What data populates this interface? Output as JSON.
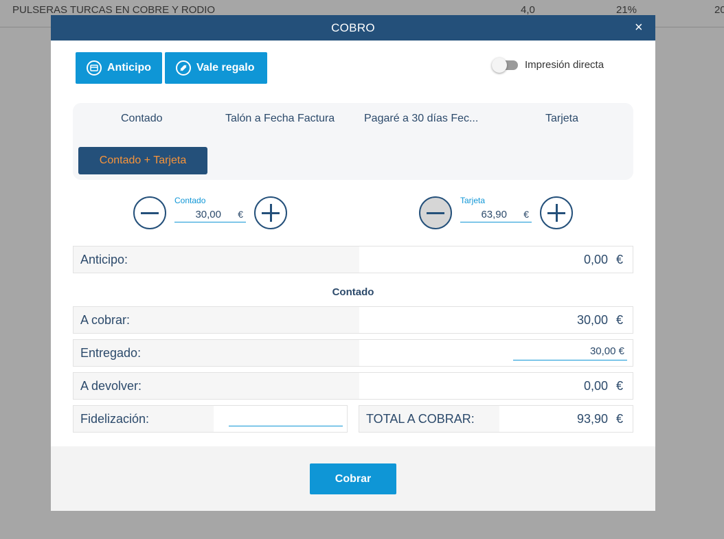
{
  "background_row": {
    "description": "PULSERAS TURCAS EN COBRE Y RODIO",
    "quantity": "4,0",
    "vat": "21%",
    "more": "20"
  },
  "modal": {
    "title": "COBRO",
    "close_symbol": "×",
    "anticipo_button": "Anticipo",
    "vale_button": "Vale regalo",
    "direct_print_label": "Impresión directa",
    "direct_print_on": false,
    "methods": [
      "Contado",
      "Talón a Fecha Factura",
      "Pagaré a 30 días Fec...",
      "Tarjeta"
    ],
    "active_method": "Contado + Tarjeta",
    "contado_amount": {
      "label": "Contado",
      "value": "30,00",
      "currency": "€"
    },
    "tarjeta_amount": {
      "label": "Tarjeta",
      "value": "63,90",
      "currency": "€"
    },
    "anticipo_row": {
      "label": "Anticipo:",
      "value": "0,00",
      "currency": "€"
    },
    "section_title": "Contado",
    "a_cobrar_row": {
      "label": "A cobrar:",
      "value": "30,00",
      "currency": "€"
    },
    "entregado_row": {
      "label": "Entregado:",
      "value": "30,00 €"
    },
    "a_devolver_row": {
      "label": "A devolver:",
      "value": "0,00",
      "currency": "€"
    },
    "fidelizacion_label": "Fidelización:",
    "total_row": {
      "label": "TOTAL A COBRAR:",
      "value": "93,90",
      "currency": "€"
    },
    "cobrar_button": "Cobrar"
  },
  "colors": {
    "header": "#24507a",
    "primary_button": "#0f96d6",
    "active_method_text": "#f7943a"
  }
}
